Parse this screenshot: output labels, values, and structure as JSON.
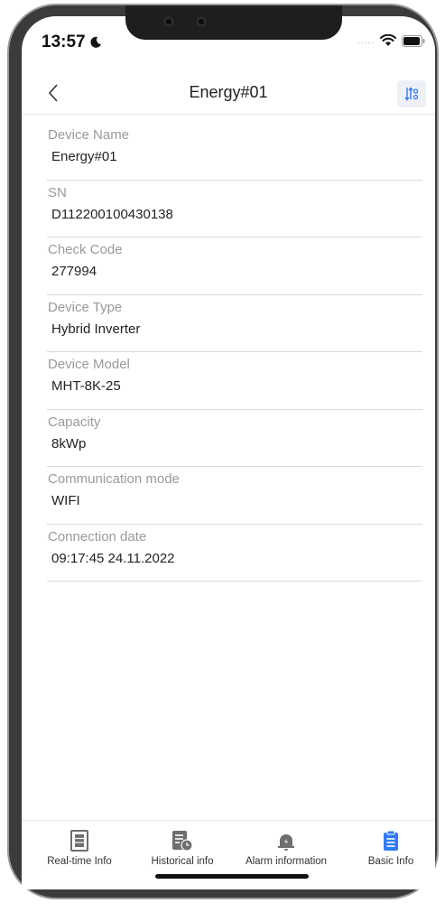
{
  "status_bar": {
    "time": "13:57",
    "signal": "....."
  },
  "header": {
    "title": "Energy#01"
  },
  "fields": [
    {
      "label": "Device Name",
      "value": "Energy#01"
    },
    {
      "label": "SN",
      "value": "D112200100430138"
    },
    {
      "label": "Check Code",
      "value": "277994"
    },
    {
      "label": "Device Type",
      "value": "Hybrid Inverter"
    },
    {
      "label": "Device Model",
      "value": "MHT-8K-25"
    },
    {
      "label": "Capacity",
      "value": "8kWp"
    },
    {
      "label": "Communication mode",
      "value": "WIFI"
    },
    {
      "label": "Connection date",
      "value": "09:17:45 24.11.2022"
    }
  ],
  "tabbar": {
    "tabs": [
      {
        "label": "Real-time Info",
        "icon": "realtime-info-icon"
      },
      {
        "label": "Historical info",
        "icon": "historical-info-icon"
      },
      {
        "label": "Alarm information",
        "icon": "alarm-bell-icon"
      },
      {
        "label": "Basic Info",
        "icon": "basic-info-icon",
        "active": true
      }
    ]
  },
  "colors": {
    "accent": "#2f7bf5",
    "inactive_icon": "#6e6e6e",
    "label": "#9a9a9a",
    "text": "#222222"
  }
}
